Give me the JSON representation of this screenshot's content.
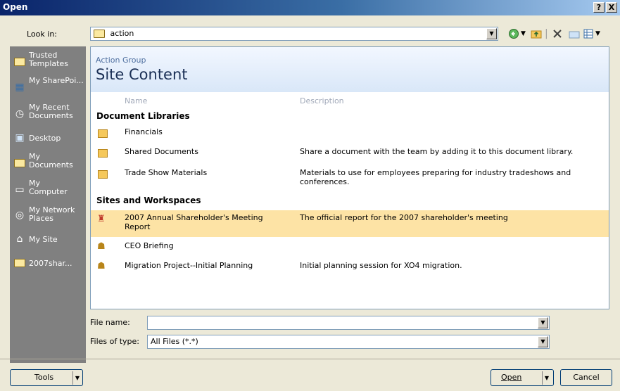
{
  "window": {
    "title": "Open",
    "help_glyph": "?",
    "close_glyph": "X"
  },
  "look_in": {
    "label": "Look in:",
    "value": "action",
    "icons": [
      "back-icon",
      "up-folder-icon",
      "delete-icon",
      "new-folder-icon",
      "views-icon"
    ]
  },
  "places": [
    {
      "label": "Trusted Templates",
      "icon": "folder-icon"
    },
    {
      "label": "My SharePoi...",
      "icon": "sharepoint-icon"
    },
    {
      "label": "My Recent Documents",
      "icon": "recent-documents-icon"
    },
    {
      "label": "Desktop",
      "icon": "desktop-icon"
    },
    {
      "label": "My Documents",
      "icon": "my-documents-icon"
    },
    {
      "label": "My Computer",
      "icon": "computer-icon"
    },
    {
      "label": "My Network Places",
      "icon": "network-places-icon"
    },
    {
      "label": "My Site",
      "icon": "my-site-icon"
    },
    {
      "label": "2007shar...",
      "icon": "folder-icon"
    }
  ],
  "site": {
    "group": "Action Group",
    "title": "Site Content",
    "columns": {
      "name": "Name",
      "description": "Description"
    },
    "document_libraries": {
      "heading": "Document Libraries",
      "items": [
        {
          "name": "Financials",
          "description": ""
        },
        {
          "name": "Shared Documents",
          "description": "Share a document with the team by adding it to this document library."
        },
        {
          "name": "Trade Show Materials",
          "description": "Materials to use for employees preparing for industry tradeshows and conferences."
        }
      ]
    },
    "sites_and_workspaces": {
      "heading": "Sites and Workspaces",
      "items": [
        {
          "name": "2007 Annual Shareholder's Meeting Report",
          "description": "The official report for the 2007 shareholder's meeting",
          "selected": true
        },
        {
          "name": "CEO Briefing",
          "description": ""
        },
        {
          "name": "Migration Project--Initial Planning",
          "description": "Initial planning session for XO4 migration."
        }
      ]
    }
  },
  "file_name": {
    "label": "File name:",
    "value": ""
  },
  "files_of_type": {
    "label": "Files of type:",
    "value": "All Files (*.*)"
  },
  "buttons": {
    "tools": "Tools",
    "open": "Open",
    "cancel": "Cancel"
  },
  "colors": {
    "title_bar": "#0a246a",
    "places_bar": "#808080",
    "selection": "#fde3a5",
    "site_header": "#d9e7f8"
  }
}
